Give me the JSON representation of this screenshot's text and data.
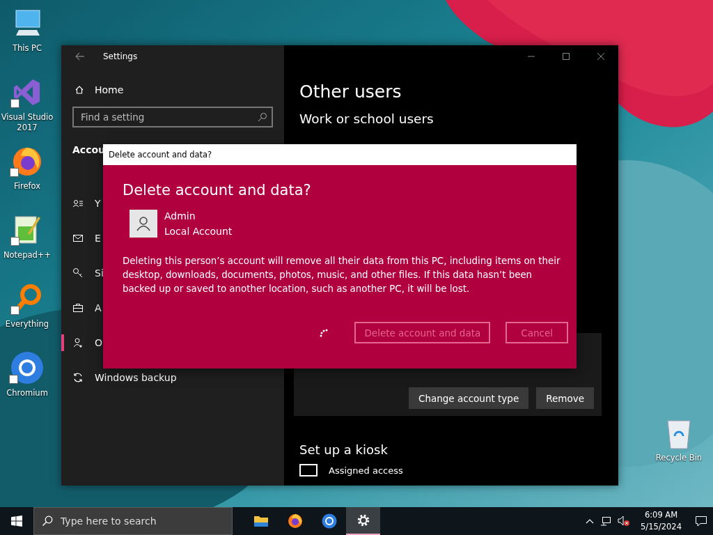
{
  "desktop_icons": [
    {
      "label": "This PC"
    },
    {
      "label": "Visual Studio 2017"
    },
    {
      "label": "Firefox"
    },
    {
      "label": "Notepad++"
    },
    {
      "label": "Everything"
    },
    {
      "label": "Chromium"
    }
  ],
  "recycle_bin": {
    "label": "Recycle Bin"
  },
  "settings_window": {
    "title": "Settings",
    "sidebar": {
      "home": "Home",
      "search": {
        "placeholder": "Find a setting"
      },
      "section": "Accou",
      "items": [
        {
          "label": "Y",
          "selected": false
        },
        {
          "label": "E",
          "selected": false
        },
        {
          "label": "Si",
          "selected": false
        },
        {
          "label": "A",
          "selected": false
        },
        {
          "label": "O",
          "selected": true
        },
        {
          "label": "Windows backup",
          "selected": false
        }
      ]
    },
    "content": {
      "heading": "Other users",
      "subheading": "Work or school users",
      "buttons": [
        "Change account type",
        "Remove"
      ],
      "kiosk_heading": "Set up a kiosk",
      "kiosk_item": "Assigned access"
    }
  },
  "dialog": {
    "title": "Delete account and data?",
    "heading": "Delete account and data?",
    "account": {
      "name": "Admin",
      "type": "Local Account"
    },
    "message": "Deleting this person’s account will remove all their data from this PC, including items on their desktop, downloads, documents, photos, music, and other files. If this data hasn’t been backed up or saved to another location, such as another PC, it will be lost.",
    "busy": true,
    "buttons": [
      {
        "label": "Delete account and data",
        "disabled": true
      },
      {
        "label": "Cancel",
        "disabled": true
      }
    ]
  },
  "taskbar": {
    "search": {
      "placeholder": "Type here to search"
    },
    "apps": [
      {
        "selected": false
      },
      {
        "selected": false
      },
      {
        "selected": false
      },
      {
        "selected": true
      }
    ],
    "time": "6:09 AM",
    "date": "5/15/2024"
  }
}
